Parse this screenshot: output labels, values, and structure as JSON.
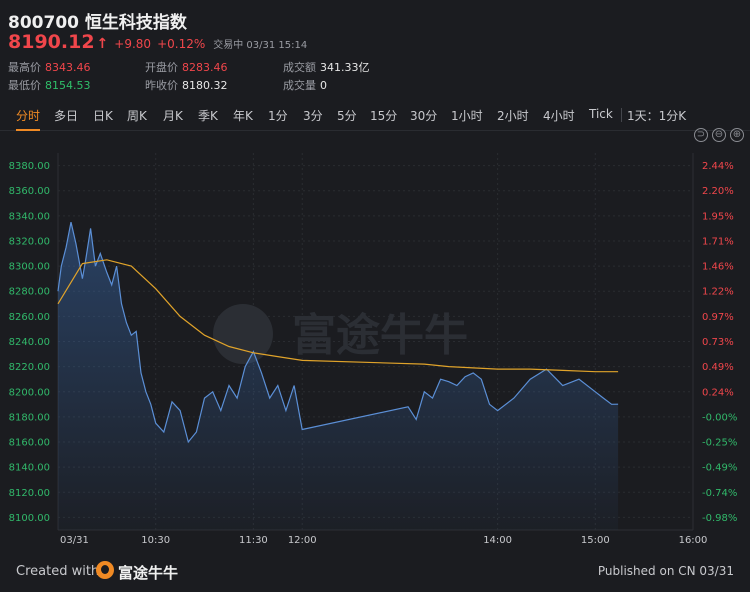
{
  "header": {
    "title": "800700 恒生科技指数",
    "price": "8190.12",
    "change": "+9.80",
    "change_pct": "+0.12%",
    "status": "交易中 03/31 15:14"
  },
  "stats": {
    "high_label": "最高价",
    "high": "8343.46",
    "low_label": "最低价",
    "low": "8154.53",
    "open_label": "开盘价",
    "open": "8283.46",
    "prev_label": "昨收价",
    "prev": "8180.32",
    "turnover_label": "成交额",
    "turnover": "341.33亿",
    "volume_label": "成交量",
    "volume": "0"
  },
  "tabs": [
    "分时",
    "多日",
    "日K",
    "周K",
    "月K",
    "季K",
    "年K",
    "1分",
    "3分",
    "5分",
    "15分",
    "30分",
    "1小时",
    "2小时",
    "4小时",
    "Tick",
    "1天：1分K"
  ],
  "active_tab": "分时",
  "controls": [
    "⊃",
    "⊖",
    "⊕"
  ],
  "watermark": "富途牛牛",
  "footer": {
    "created": "Created with",
    "brand": "富途牛牛",
    "published": "Published on CN 03/31"
  },
  "colors": {
    "up": "#f0464b",
    "down": "#2fbf6a",
    "line": "#5b8fd6",
    "avg": "#e0a32a",
    "accent": "#f08a24"
  },
  "chart_data": {
    "type": "line",
    "prev_close": 8180.32,
    "ylim": [
      8090,
      8390
    ],
    "y_ticks": [
      8100,
      8120,
      8140,
      8160,
      8180,
      8200,
      8220,
      8240,
      8260,
      8280,
      8300,
      8320,
      8340,
      8360,
      8380
    ],
    "y_tick_labels": [
      "8100.00",
      "8120.00",
      "8140.00",
      "8160.00",
      "8180.00",
      "8200.00",
      "8220.00",
      "8240.00",
      "8260.00",
      "8280.00",
      "8300.00",
      "8320.00",
      "8340.00",
      "8360.00",
      "8380.00"
    ],
    "pct_tick_labels": [
      "-0.98%",
      "-0.74%",
      "-0.49%",
      "-0.25%",
      "-0.00%",
      "0.24%",
      "0.49%",
      "0.73%",
      "0.97%",
      "1.22%",
      "1.46%",
      "1.71%",
      "1.95%",
      "2.20%",
      "2.44%"
    ],
    "x_labels": [
      "03/31",
      "10:30",
      "11:30",
      "12:00",
      "14:00",
      "15:00",
      "16:00"
    ],
    "x_label_times": [
      "09:30",
      "10:30",
      "11:30",
      "12:00",
      "14:00",
      "15:00",
      "16:00"
    ],
    "series": [
      {
        "x": [
          "09:30",
          "09:32",
          "09:35",
          "09:38",
          "09:41",
          "09:45",
          "09:47",
          "09:50",
          "09:53",
          "09:56",
          "10:00",
          "10:03",
          "10:06",
          "10:09",
          "10:12",
          "10:15",
          "10:18",
          "10:21",
          "10:24",
          "10:27",
          "10:30",
          "10:35",
          "10:40",
          "10:45",
          "10:50",
          "10:55",
          "11:00",
          "11:05",
          "11:10",
          "11:15",
          "11:20",
          "11:25",
          "11:30",
          "11:35",
          "11:40",
          "11:45",
          "11:50",
          "11:55",
          "12:00",
          "13:05",
          "13:10",
          "13:15",
          "13:20",
          "13:25",
          "13:30",
          "13:35",
          "13:40",
          "13:45",
          "13:50",
          "13:55",
          "14:00",
          "14:10",
          "14:20",
          "14:30",
          "14:40",
          "14:50",
          "15:00",
          "15:05",
          "15:10",
          "15:14"
        ],
        "values": [
          8280,
          8300,
          8315,
          8335,
          8318,
          8290,
          8305,
          8330,
          8300,
          8310,
          8295,
          8285,
          8300,
          8270,
          8255,
          8245,
          8248,
          8215,
          8200,
          8190,
          8175,
          8168,
          8192,
          8185,
          8160,
          8168,
          8195,
          8200,
          8185,
          8205,
          8195,
          8220,
          8232,
          8215,
          8195,
          8205,
          8185,
          8205,
          8170,
          8188,
          8178,
          8200,
          8195,
          8210,
          8208,
          8205,
          8212,
          8215,
          8210,
          8190,
          8185,
          8195,
          8210,
          8218,
          8205,
          8210,
          8200,
          8195,
          8190,
          8190.12
        ]
      },
      {
        "x": [
          "09:30",
          "09:45",
          "10:00",
          "10:15",
          "10:30",
          "10:45",
          "11:00",
          "11:15",
          "11:30",
          "11:45",
          "12:00",
          "13:15",
          "13:30",
          "13:45",
          "14:00",
          "14:20",
          "14:40",
          "15:00",
          "15:14"
        ],
        "values": [
          8270,
          8302,
          8305,
          8300,
          8282,
          8260,
          8245,
          8236,
          8231,
          8228,
          8225,
          8222,
          8220,
          8219,
          8218,
          8218,
          8217,
          8216,
          8216
        ]
      }
    ]
  }
}
